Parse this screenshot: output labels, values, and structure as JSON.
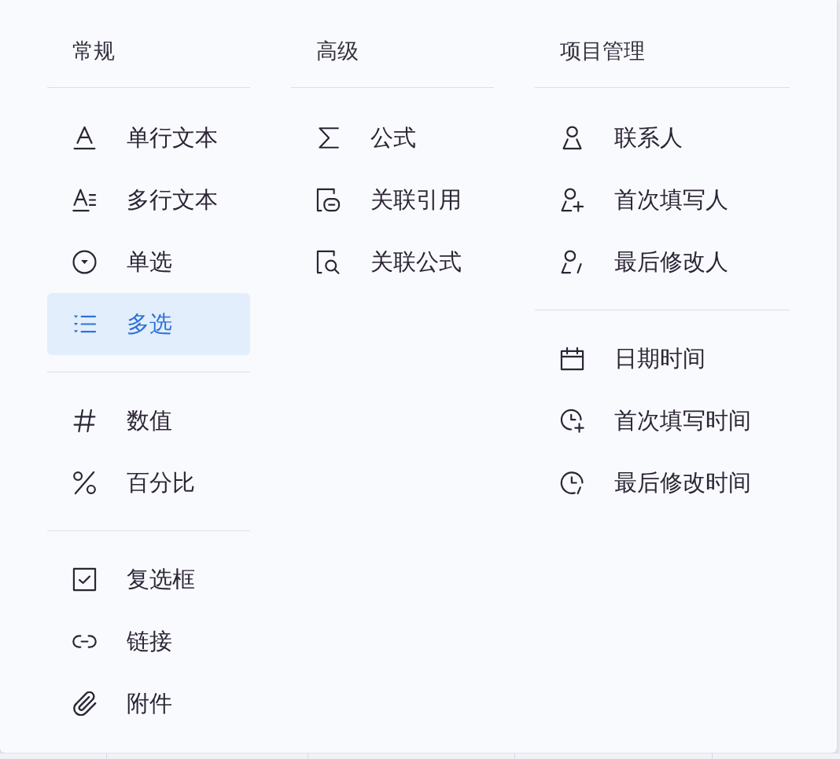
{
  "columns": [
    {
      "title": "常规",
      "groups": [
        {
          "items": [
            {
              "label": "单行文本",
              "kind": "text",
              "selected": false
            },
            {
              "label": "多行文本",
              "kind": "textarea",
              "selected": false
            },
            {
              "label": "单选",
              "kind": "radio",
              "selected": false
            },
            {
              "label": "多选",
              "kind": "multi",
              "selected": true
            }
          ]
        },
        {
          "items": [
            {
              "label": "数值",
              "kind": "number",
              "selected": false
            },
            {
              "label": "百分比",
              "kind": "percent",
              "selected": false
            }
          ]
        },
        {
          "items": [
            {
              "label": "复选框",
              "kind": "checkbox",
              "selected": false
            },
            {
              "label": "链接",
              "kind": "link",
              "selected": false
            },
            {
              "label": "附件",
              "kind": "attachment",
              "selected": false
            }
          ]
        }
      ]
    },
    {
      "title": "高级",
      "groups": [
        {
          "items": [
            {
              "label": "公式",
              "kind": "formula",
              "selected": false
            },
            {
              "label": "关联引用",
              "kind": "reference",
              "selected": false
            },
            {
              "label": "关联公式",
              "kind": "lookup",
              "selected": false
            }
          ]
        }
      ]
    },
    {
      "title": "项目管理",
      "groups": [
        {
          "items": [
            {
              "label": "联系人",
              "kind": "contact",
              "selected": false
            },
            {
              "label": "首次填写人",
              "kind": "creator",
              "selected": false
            },
            {
              "label": "最后修改人",
              "kind": "modifier",
              "selected": false
            }
          ]
        },
        {
          "items": [
            {
              "label": "日期时间",
              "kind": "datetime",
              "selected": false
            },
            {
              "label": "首次填写时间",
              "kind": "created-time",
              "selected": false
            },
            {
              "label": "最后修改时间",
              "kind": "modified-time",
              "selected": false
            }
          ]
        }
      ]
    }
  ]
}
